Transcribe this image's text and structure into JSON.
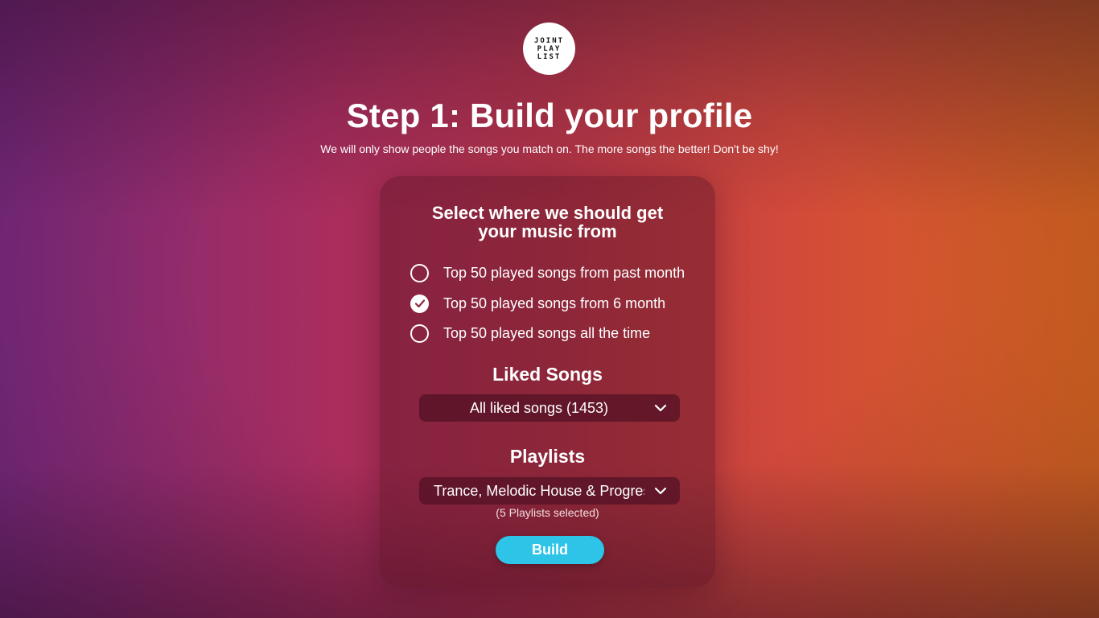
{
  "app": {
    "logo_lines": [
      "JOINT",
      "PLAY",
      "LIST"
    ]
  },
  "header": {
    "title": "Step 1: Build your profile",
    "subtitle": "We will only show people the songs you match on. The more songs the better! Don't be shy!"
  },
  "card": {
    "heading_lines": [
      "Select where we should get",
      "your music from"
    ],
    "options": [
      {
        "label": "Top 50 played songs from past month",
        "checked": false
      },
      {
        "label": "Top 50 played songs from 6 month",
        "checked": true
      },
      {
        "label": "Top 50 played songs all the time",
        "checked": false
      }
    ],
    "liked_songs": {
      "title": "Liked Songs",
      "selected": "All liked songs (1453)"
    },
    "playlists": {
      "title": "Playlists",
      "selected": "Trance, Melodic House & Progressive",
      "note": "(5 Playlists selected)"
    },
    "build_label": "Build"
  },
  "colors": {
    "accent": "#2ec4e8",
    "card_bg": "#5a1428"
  },
  "icons": {
    "check": "check-icon",
    "dropdown": "chevron-down-icon"
  }
}
